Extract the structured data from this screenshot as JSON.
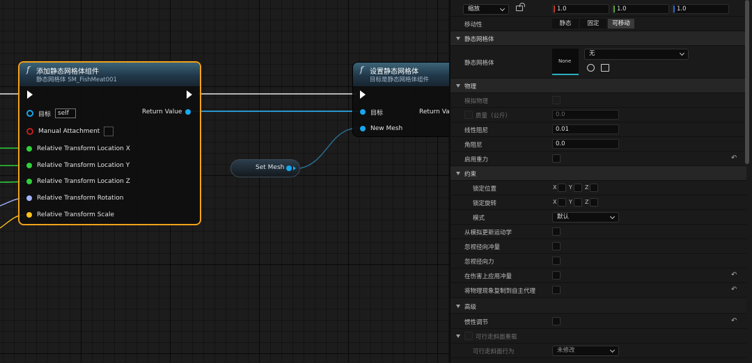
{
  "graph": {
    "node_add": {
      "title": "添加静态网格体组件",
      "subtitle": "静态网格体 SM_FishMeat001",
      "target_label": "目标",
      "target_value": "self",
      "return_label": "Return Value",
      "manual_attachment": "Manual Attachment",
      "pins": [
        {
          "label": "Relative Transform Location X",
          "color": "#2fd13a"
        },
        {
          "label": "Relative Transform Location Y",
          "color": "#2fd13a"
        },
        {
          "label": "Relative Transform Location Z",
          "color": "#2fd13a"
        },
        {
          "label": "Relative Transform Rotation",
          "color": "#a3b3ff"
        },
        {
          "label": "Relative Transform Scale",
          "color": "#ffc21a"
        }
      ],
      "exec_icon": "exec-arrow-icon",
      "function_icon": "function-icon"
    },
    "node_set": {
      "title": "设置静态网格体",
      "subtitle": "目标是静态网格体组件",
      "target_label": "目标",
      "return_label": "Return Va",
      "new_mesh_label": "New Mesh"
    },
    "set_mesh_label": "Set Mesh",
    "colors": {
      "object_pin": "#18a7ee",
      "exec": "#ffffff",
      "selected_border": "#f3a21b",
      "manual_attach_pin": "#c31f1f"
    }
  },
  "details": {
    "scale": {
      "mode": "缩放",
      "x": "1.0",
      "y": "1.0",
      "z": "1.0",
      "lock_icon": "lock-icon"
    },
    "mobility": {
      "label": "移动性",
      "options": [
        "静态",
        "固定",
        "可移动"
      ],
      "selected": "可移动"
    },
    "cat_static_mesh": "静态网格体",
    "static_mesh": {
      "label": "静态网格体",
      "thumb_text": "None",
      "value": "无",
      "browse_icon": "use-selected-icon",
      "find_icon": "browse-icon"
    },
    "cat_physics": "物理",
    "physics": {
      "simulate": "模拟物理",
      "mass": "质量（公斤）",
      "mass_value": "0.0",
      "linear_damping": "线性阻尼",
      "linear_damping_value": "0.01",
      "angular_damping": "角阻尼",
      "angular_damping_value": "0.0",
      "enable_gravity": "启用重力"
    },
    "cat_constraints": "约束",
    "constraints": {
      "lock_position": "锁定位置",
      "lock_rotation": "锁定旋转",
      "axes": [
        "X",
        "Y",
        "Z"
      ],
      "mode": "模式",
      "mode_value": "默认"
    },
    "more": [
      "从模拟更新运动学",
      "忽视径向冲量",
      "忽视径向力",
      "在伤害上应用冲量",
      "将物理现象复制到自主代理"
    ],
    "cat_advanced": "高级",
    "advanced": {
      "inertia": "惯性调节",
      "walkable_override": "可行走斜面重载",
      "walkable_behavior": "可行走斜面行为",
      "walkable_value": "未修改"
    },
    "reset_icon": "reset-arrow-icon"
  }
}
